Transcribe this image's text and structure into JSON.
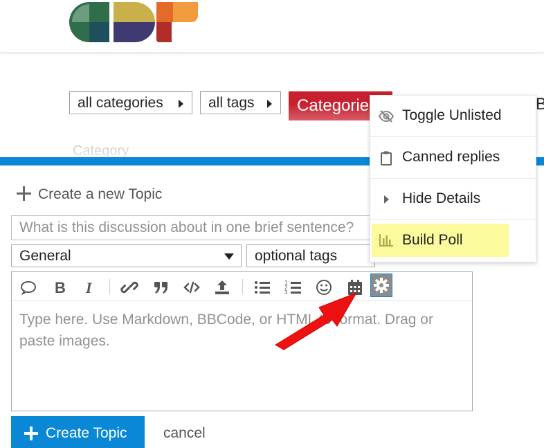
{
  "brand": {
    "logo_name": "ADF logo"
  },
  "nav": {
    "categories_label": "all categories",
    "tags_label": "all tags",
    "active_pill": "Categories",
    "cut_text": "B"
  },
  "category_header": "Category",
  "composer": {
    "title": "Create a new Topic",
    "title_placeholder": "What is this discussion about in one brief sentence?",
    "category_value": "General",
    "tags_placeholder": "optional tags",
    "editor_placeholder": "Type here. Use Markdown, BBCode, or HTML to format. Drag or paste images.",
    "create_button": "Create Topic",
    "cancel": "cancel",
    "toolbar_icons": [
      "speech-bubble",
      "bold",
      "italic",
      "link",
      "quote",
      "code",
      "upload",
      "bullet-list",
      "numbered-list",
      "emoji",
      "calendar",
      "gear"
    ]
  },
  "popup_menu": {
    "items": [
      {
        "label": "Toggle Unlisted",
        "icon": "eye-slash"
      },
      {
        "label": "Canned replies",
        "icon": "clipboard"
      },
      {
        "label": "Hide Details",
        "icon": "caret-right"
      },
      {
        "label": "Build Poll",
        "icon": "bar-chart",
        "highlighted": true
      }
    ]
  },
  "colors": {
    "accent_blue": "#0a88d6",
    "pill_red": "#c8202f",
    "highlight_yellow": "#fbfb9d",
    "annotation_arrow": "#ee1111"
  }
}
